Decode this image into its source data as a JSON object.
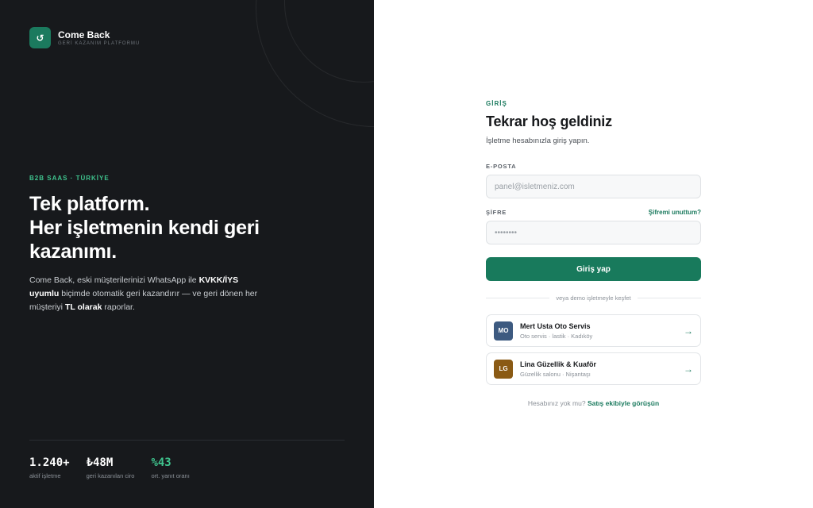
{
  "brand": {
    "logo_glyph": "↺",
    "name": "Come Back",
    "tagline": "GERİ KAZANIM PLATFORMU"
  },
  "hero": {
    "eyebrow": "B2B SAAS · TÜRKİYE",
    "headline_line1": "Tek platform.",
    "headline_line2": "Her işletmenin kendi geri",
    "headline_line3": "kazanımı.",
    "desc_part1": "Come Back, eski müşterilerinizi WhatsApp ile ",
    "desc_bold1": "KVKK/İYS uyumlu",
    "desc_part2": " biçimde otomatik geri kazandırır — ve geri dönen her müşteriyi ",
    "desc_bold2": "TL olarak",
    "desc_part3": " raporlar."
  },
  "stats": [
    {
      "value": "1.240+",
      "label": "aktif işletme"
    },
    {
      "value": "₺48M",
      "label": "geri kazanılan ciro"
    },
    {
      "value": "%43",
      "label": "ort. yanıt oranı"
    }
  ],
  "form": {
    "eyebrow": "GİRİŞ",
    "title": "Tekrar hoş geldiniz",
    "subtitle": "İşletme hesabınızla giriş yapın.",
    "email_label": "E-POSTA",
    "email_placeholder": "panel@isletmeniz.com",
    "password_label": "ŞİFRE",
    "forgot_label": "Şifremi unuttum?",
    "password_placeholder": "••••••••",
    "submit_label": "Giriş yap",
    "divider_text": "veya demo işletmeyle keşfet"
  },
  "demos": [
    {
      "initials": "MO",
      "name": "Mert Usta Oto Servis",
      "sub": "Oto servis · lastik · Kadıköy",
      "color": "#3d5a80"
    },
    {
      "initials": "LG",
      "name": "Lina Güzellik & Kuaför",
      "sub": "Güzellik salonu · Nişantaşı",
      "color": "#8a5a14"
    }
  ],
  "footer": {
    "text": "Hesabınız yok mu? ",
    "link": "Satış ekibiyle görüşün"
  },
  "colors": {
    "accent": "#1b7a5e",
    "accent_bright": "#3fc48e",
    "dark_panel": "#17191c"
  }
}
